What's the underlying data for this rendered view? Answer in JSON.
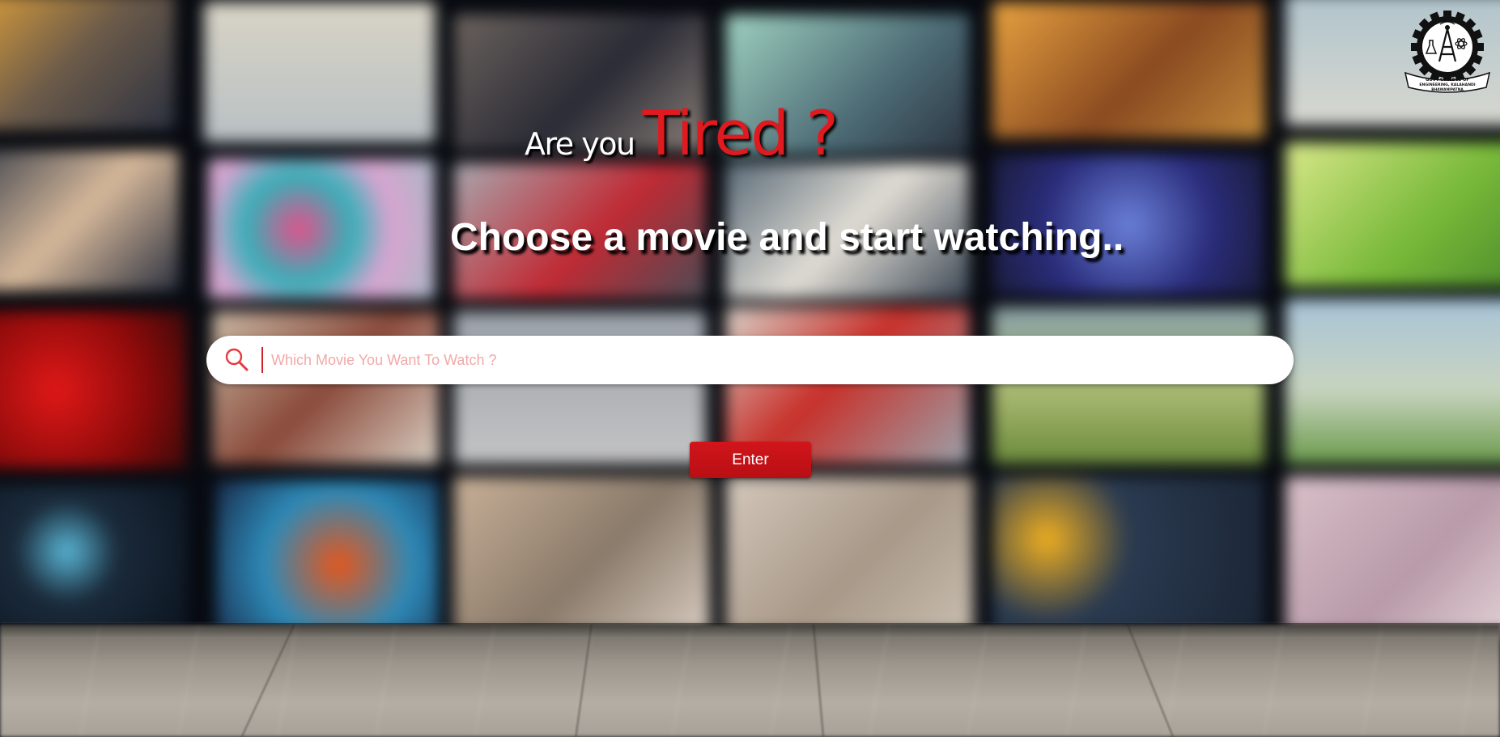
{
  "headline": {
    "prefix": "Are you",
    "emphasis": "Tired ?"
  },
  "subheadline": "Choose a movie and start watching..",
  "search": {
    "placeholder": "Which Movie You Want To Watch ?",
    "value": "",
    "icon": "search-icon"
  },
  "enter_button": {
    "label": "Enter"
  },
  "logo": {
    "icon": "college-emblem-icon",
    "text": "GOVT COLLEGE OF ENGINEERING, KALAHANDI BHAWANIPATNA"
  },
  "colors": {
    "accent": "#e01a1f",
    "button": "#c8141a",
    "placeholder": "#f2a8a8"
  }
}
